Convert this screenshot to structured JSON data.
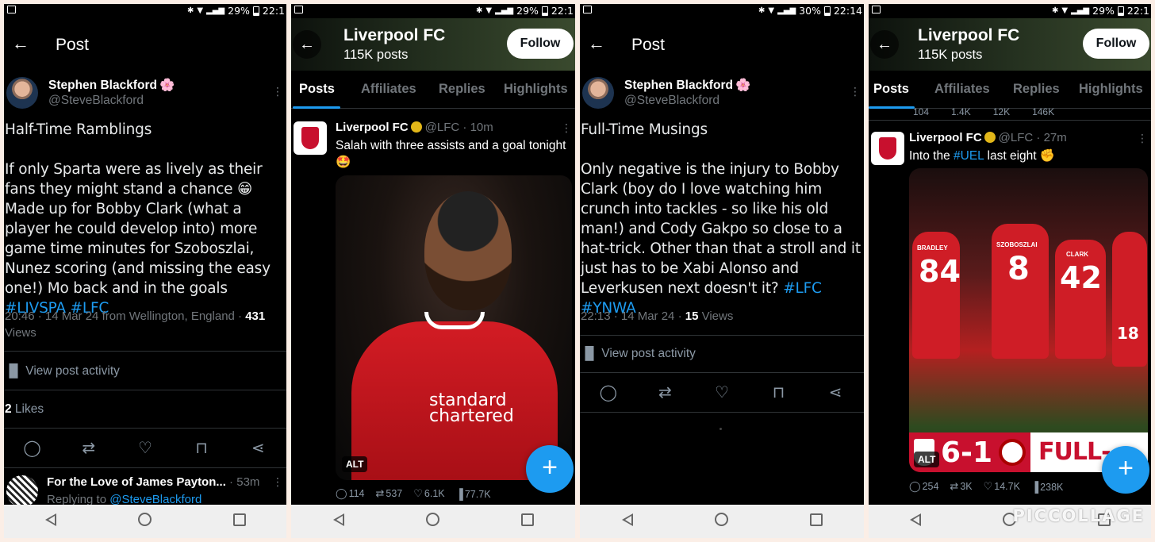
{
  "status_bars": [
    {
      "battery": "29%",
      "time": "22:1"
    },
    {
      "battery": "29%",
      "time": "22:1"
    },
    {
      "battery": "30%",
      "time": "22:14"
    },
    {
      "battery": "29%",
      "time": "22:1"
    }
  ],
  "screen1": {
    "header_title": "Post",
    "author_name": "Stephen Blackford",
    "author_emoji": "🌸",
    "author_handle": "@SteveBlackford",
    "body_line1": "Half-Time Ramblings",
    "body_para_prefix": "If only Sparta were as lively as their fans they might stand a chance 😁 Made up for Bobby Clark (what a player he could develop into) more game time minutes for Szoboszlai, Nunez scoring (and missing the easy one!) Mo back and in the goals ",
    "hashtags": "#LIVSPA #LFC",
    "meta_prefix": "20:46 · 14 Mar 24 from Wellington, England · ",
    "views_count": "431",
    "views_label": " Views",
    "view_activity": "View post activity",
    "likes_count": "2",
    "likes_label": " Likes",
    "reply_name": "For the Love of James Payton...",
    "reply_time": " · 53m",
    "reply_prefix": "Replying to ",
    "reply_handle": "@SteveBlackford"
  },
  "screen2": {
    "profile_name": "Liverpool FC",
    "post_count": "115K posts",
    "follow_label": "Follow",
    "tabs": [
      "Posts",
      "Affiliates",
      "Replies",
      "Highlights"
    ],
    "post_author": "Liverpool FC",
    "post_meta": "@LFC · 10m",
    "post_text": "Salah with three assists and a goal tonight 🤩",
    "sponsor_text": "standard chartered",
    "alt_label": "ALT",
    "stats": {
      "replies": "114",
      "reposts": "537",
      "likes": "6.1K",
      "views": "77.7K"
    },
    "fab_label": "+"
  },
  "screen3": {
    "header_title": "Post",
    "author_name": "Stephen Blackford",
    "author_emoji": "🌸",
    "author_handle": "@SteveBlackford",
    "body_line1": "Full-Time Musings",
    "body_para_prefix": "Only negative is the injury to Bobby Clark (boy do I love watching him crunch into tackles - so like his old man!) and Cody Gakpo so close to a hat-trick. Other than that a stroll and it just has to be Xabi Alonso and Leverkusen next doesn't it? ",
    "hashtags": "#LFC #YNWA",
    "meta_prefix": "22:13 · 14 Mar 24 · ",
    "views_count": "15",
    "views_label": " Views",
    "view_activity": "View post activity"
  },
  "screen4": {
    "profile_name": "Liverpool FC",
    "post_count": "115K posts",
    "follow_label": "Follow",
    "tabs": [
      "Posts",
      "Affiliates",
      "Replies",
      "Highlights"
    ],
    "partial_stats": [
      "104",
      "1.4K",
      "12K",
      "146K"
    ],
    "post_author": "Liverpool FC",
    "post_meta": "@LFC · 27m",
    "post_text_prefix": "Into the ",
    "post_hashtag": "#UEL",
    "post_text_suffix": " last eight ✊",
    "player_names": [
      "BRADLEY",
      "SZOBOSZLAI",
      "CLARK"
    ],
    "player_numbers": [
      "84",
      "8",
      "42",
      "18"
    ],
    "score": "6-1",
    "scoreboard_label": "FULL-TIME",
    "alt_label": "ALT",
    "stats": {
      "replies": "254",
      "reposts": "3K",
      "likes": "14.7K",
      "views": "238K"
    },
    "fab_label": "+"
  },
  "watermark": "PICCOLLAGE"
}
